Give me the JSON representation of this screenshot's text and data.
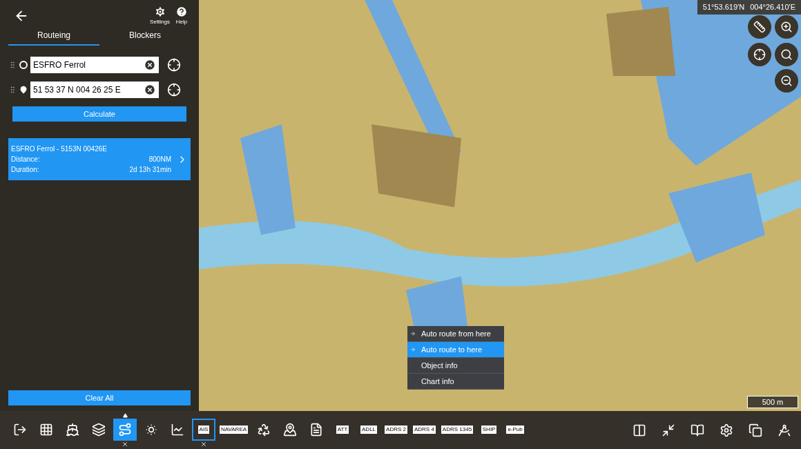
{
  "panel": {
    "buttons": [
      {
        "label": "Settings"
      },
      {
        "label": "Help"
      }
    ],
    "tabs": [
      {
        "label": "Routeing",
        "selected": true
      },
      {
        "label": "Blockers",
        "selected": false
      }
    ],
    "waypoints": [
      {
        "kind": "origin",
        "value": "ESFRO Ferrol"
      },
      {
        "kind": "destination",
        "value": "51 53 37 N 004 26 25 E"
      }
    ],
    "calculate": "Calculate",
    "routes": [
      {
        "title": "ESFRO Ferrol - 5153N 00426E",
        "rows": [
          {
            "label": "Distance:",
            "value": "800NM"
          },
          {
            "label": "Duration:",
            "value": "2d 13h 31min"
          }
        ]
      }
    ],
    "clear": "Clear All"
  },
  "map": {
    "coordinates": [
      "51°53.619'N",
      "004°26.410'E"
    ],
    "scale": "500 m",
    "context_menu": [
      {
        "kind": "route",
        "label": "Auto route from here",
        "selected": false
      },
      {
        "kind": "route",
        "label": "Auto route to here",
        "selected": true
      },
      {
        "kind": "info",
        "label": "Object info",
        "selected": false
      },
      {
        "kind": "info",
        "label": "Chart info",
        "selected": false
      }
    ]
  },
  "toolbar": {
    "left": [
      {
        "kind": "icon",
        "selected": false,
        "expanded": false
      },
      {
        "kind": "icon",
        "selected": false,
        "expanded": false
      },
      {
        "kind": "icon",
        "selected": false,
        "expanded": false
      },
      {
        "kind": "icon",
        "selected": false,
        "expanded": false
      },
      {
        "kind": "icon",
        "selected": true,
        "outlined": false,
        "expanded": true
      },
      {
        "kind": "icon",
        "selected": false,
        "expanded": false
      },
      {
        "kind": "icon",
        "selected": false,
        "expanded": false
      },
      {
        "kind": "tag",
        "label": "AIS",
        "selected": true,
        "outlined": true,
        "expanded": false
      },
      {
        "kind": "tag",
        "label": "NAVAREA",
        "selected": false,
        "expanded": false
      },
      {
        "kind": "icon",
        "selected": false,
        "expanded": false
      },
      {
        "kind": "icon",
        "selected": false,
        "expanded": false
      },
      {
        "kind": "icon",
        "selected": false,
        "expanded": false
      },
      {
        "kind": "tag",
        "label": "ATT",
        "selected": false,
        "expanded": false
      },
      {
        "kind": "tag",
        "label": "ADLL",
        "selected": false,
        "expanded": false
      },
      {
        "kind": "tag",
        "label": "ADRS 2",
        "selected": false,
        "expanded": false
      },
      {
        "kind": "tag",
        "label": "ADRS 4",
        "selected": false,
        "expanded": false
      },
      {
        "kind": "tag",
        "label": "ADRS 1345",
        "selected": false,
        "expanded": false
      },
      {
        "kind": "tag",
        "label": "SHIP",
        "selected": false,
        "expanded": false
      },
      {
        "kind": "tag",
        "label": "e-Pub",
        "selected": false,
        "expanded": false
      }
    ]
  }
}
